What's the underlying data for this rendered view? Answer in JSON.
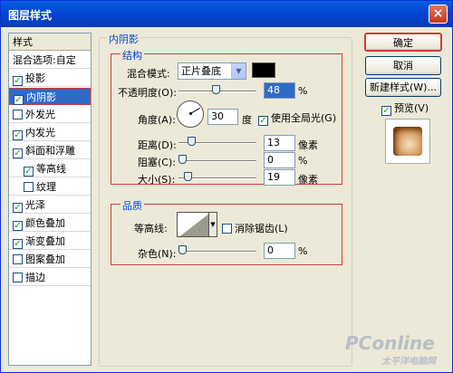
{
  "window": {
    "title": "图层样式",
    "close": "×"
  },
  "styles_list": {
    "header": "样式",
    "blend_options": "混合选项:自定",
    "items": [
      {
        "label": "投影",
        "checked": true
      },
      {
        "label": "内阴影",
        "checked": true,
        "selected": true
      },
      {
        "label": "外发光",
        "checked": false
      },
      {
        "label": "内发光",
        "checked": true
      },
      {
        "label": "斜面和浮雕",
        "checked": true
      },
      {
        "label": "等高线",
        "checked": true,
        "indent": true
      },
      {
        "label": "纹理",
        "checked": false,
        "indent": true
      },
      {
        "label": "光泽",
        "checked": true
      },
      {
        "label": "颜色叠加",
        "checked": true
      },
      {
        "label": "渐变叠加",
        "checked": true
      },
      {
        "label": "图案叠加",
        "checked": false
      },
      {
        "label": "描边",
        "checked": false
      }
    ]
  },
  "panel": {
    "title": "内阴影",
    "structure": {
      "legend": "结构",
      "blend_mode_label": "混合模式:",
      "blend_mode_value": "正片叠底",
      "opacity_label": "不透明度(O):",
      "opacity_value": "48",
      "angle_label": "角度(A):",
      "angle_value": "30",
      "degree_unit": "度",
      "global_light_label": "使用全局光(G)",
      "distance_label": "距离(D):",
      "distance_value": "13",
      "choke_label": "阻塞(C):",
      "choke_value": "0",
      "size_label": "大小(S):",
      "size_value": "19",
      "pixel_unit": "像素",
      "percent": "%"
    },
    "quality": {
      "legend": "品质",
      "contour_label": "等高线:",
      "antialias_label": "消除锯齿(L)",
      "noise_label": "杂色(N):",
      "noise_value": "0",
      "percent": "%"
    }
  },
  "buttons": {
    "ok": "确定",
    "cancel": "取消",
    "new_style": "新建样式(W)...",
    "preview_label": "预览(V)"
  },
  "watermark": {
    "brand": "PConline",
    "sub": "太平洋电脑网"
  },
  "colors": {
    "accent": "#316ac5",
    "highlight": "#d13b3b",
    "shadow_color": "#000000"
  }
}
